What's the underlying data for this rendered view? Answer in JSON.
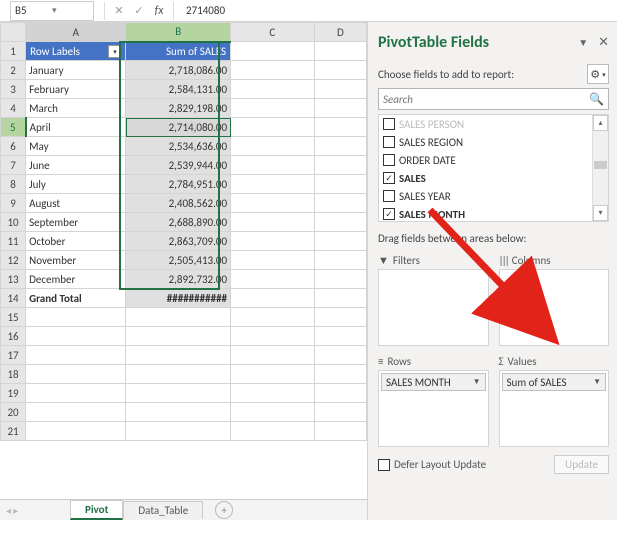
{
  "formula": {
    "nameBox": "B5",
    "value": "2714080"
  },
  "columns": [
    "A",
    "B",
    "C",
    "D"
  ],
  "headerA": "Row Labels",
  "headerB": "Sum of SALES",
  "rows": [
    {
      "n": 1
    },
    {
      "n": 2,
      "a": "January",
      "b": "2,718,086.00"
    },
    {
      "n": 3,
      "a": "February",
      "b": "2,584,131.00"
    },
    {
      "n": 4,
      "a": "March",
      "b": "2,829,198.00"
    },
    {
      "n": 5,
      "a": "April",
      "b": "2,714,080.00",
      "active": true
    },
    {
      "n": 6,
      "a": "May",
      "b": "2,534,636.00"
    },
    {
      "n": 7,
      "a": "June",
      "b": "2,539,944.00"
    },
    {
      "n": 8,
      "a": "July",
      "b": "2,784,951.00"
    },
    {
      "n": 9,
      "a": "August",
      "b": "2,408,562.00"
    },
    {
      "n": 10,
      "a": "September",
      "b": "2,688,890.00"
    },
    {
      "n": 11,
      "a": "October",
      "b": "2,863,709.00"
    },
    {
      "n": 12,
      "a": "November",
      "b": "2,505,413.00"
    },
    {
      "n": 13,
      "a": "December",
      "b": "2,892,732.00"
    },
    {
      "n": 14,
      "a": "Grand Total",
      "b": "###########",
      "gt": true
    },
    {
      "n": 15
    },
    {
      "n": 16
    },
    {
      "n": 17
    },
    {
      "n": 18
    },
    {
      "n": 19
    },
    {
      "n": 20
    },
    {
      "n": 21
    }
  ],
  "tabs": {
    "active": "Pivot",
    "other": "Data_Table"
  },
  "pane": {
    "title": "PivotTable Fields",
    "sub": "Choose fields to add to report:",
    "search": "Search",
    "fields": [
      {
        "label": "SALES PERSON",
        "checked": false,
        "cut": true
      },
      {
        "label": "SALES REGION",
        "checked": false
      },
      {
        "label": "ORDER DATE",
        "checked": false
      },
      {
        "label": "SALES",
        "checked": true,
        "bold": true
      },
      {
        "label": "SALES YEAR",
        "checked": false
      },
      {
        "label": "SALES MONTH",
        "checked": true,
        "bold": true
      }
    ],
    "dragHint": "Drag fields between areas below:",
    "areas": {
      "filters": "Filters",
      "columns": "Columns",
      "rowsLabel": "Rows",
      "valuesLabel": "Values",
      "rowPill": "SALES MONTH",
      "valPill": "Sum of SALES"
    },
    "defer": "Defer Layout Update",
    "update": "Update"
  }
}
